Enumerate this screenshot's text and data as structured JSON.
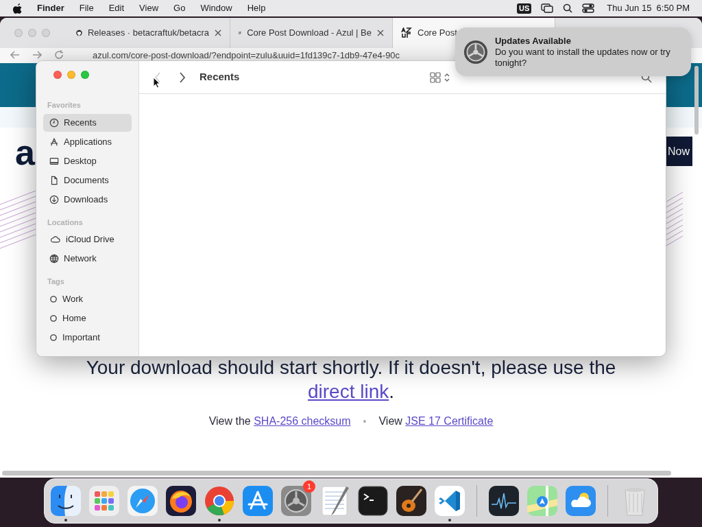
{
  "menu_bar": {
    "app": "Finder",
    "menus": [
      "File",
      "Edit",
      "View",
      "Go",
      "Window",
      "Help"
    ],
    "input_source": "US",
    "clock": "Thu Jun 15  6:50 PM"
  },
  "browser": {
    "tabs": [
      {
        "title": "Releases · betacraftuk/betacra",
        "kind": "github",
        "selected": false
      },
      {
        "title": "Core Post Download - Azul | Be",
        "kind": "azul",
        "selected": false
      },
      {
        "title": "Core Post",
        "kind": "azul",
        "selected": true
      }
    ],
    "url": "azul.com/core-post-download/?endpoint=zulu&uuid=1fd139c7-1db9-47e4-90c",
    "page": {
      "logo": "a",
      "header_button": "Now",
      "message": {
        "text": "Your download should start shortly. If it doesn't, please use the",
        "link": "direct link",
        "after": "."
      },
      "links": [
        {
          "prefix": "View the",
          "link": "SHA-256 checksum"
        },
        {
          "prefix": "View",
          "link": "JSE 17 Certificate"
        }
      ],
      "separator": "•"
    }
  },
  "finder": {
    "title": "Recents",
    "back_disabled": true,
    "forward_disabled": false,
    "sidebar": [
      {
        "heading": "Favorites",
        "items": [
          {
            "label": "Recents",
            "kind": "clock",
            "selected": true
          },
          {
            "label": "Applications",
            "kind": "apps",
            "selected": false
          },
          {
            "label": "Desktop",
            "kind": "desktop",
            "selected": false
          },
          {
            "label": "Documents",
            "kind": "doc",
            "selected": false
          },
          {
            "label": "Downloads",
            "kind": "download",
            "selected": false
          }
        ]
      },
      {
        "heading": "Locations",
        "items": [
          {
            "label": "iCloud Drive",
            "kind": "cloud",
            "selected": false
          },
          {
            "label": "Network",
            "kind": "globe",
            "selected": false
          }
        ]
      },
      {
        "heading": "Tags",
        "items": [
          {
            "label": "Work",
            "kind": "tag",
            "selected": false
          },
          {
            "label": "Home",
            "kind": "tag",
            "selected": false
          },
          {
            "label": "Important",
            "kind": "tag",
            "selected": false
          }
        ]
      }
    ]
  },
  "notification": {
    "title": "Updates Available",
    "body": "Do you want to install the updates now or try tonight?"
  },
  "dock": [
    {
      "kind": "finder",
      "running": true
    },
    {
      "kind": "launchpad",
      "running": false
    },
    {
      "kind": "safari",
      "running": false
    },
    {
      "kind": "firefox",
      "running": false
    },
    {
      "kind": "chrome",
      "running": true
    },
    {
      "kind": "appstore",
      "running": false
    },
    {
      "kind": "settings",
      "running": false,
      "badge": "1"
    },
    {
      "kind": "textedit",
      "running": false
    },
    {
      "kind": "terminal",
      "running": false
    },
    {
      "kind": "garageband",
      "running": false
    },
    {
      "kind": "vscode",
      "running": true
    },
    {
      "kind": "separator"
    },
    {
      "kind": "activity",
      "running": false
    },
    {
      "kind": "maps",
      "running": false
    },
    {
      "kind": "weather",
      "running": false
    },
    {
      "kind": "separator"
    },
    {
      "kind": "trash",
      "running": false
    }
  ]
}
